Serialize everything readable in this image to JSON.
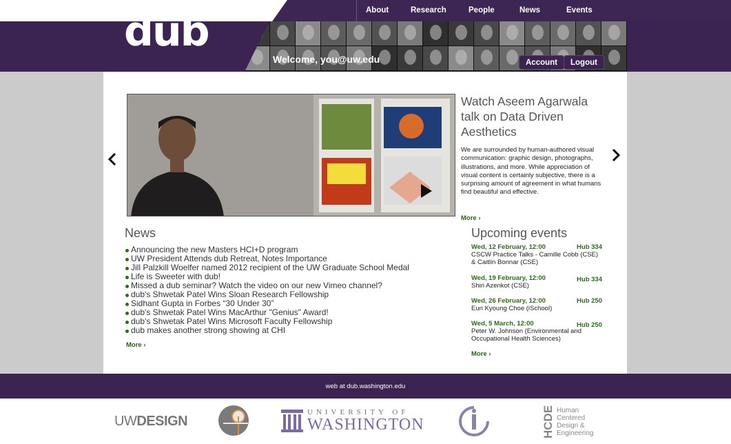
{
  "nav": {
    "items": [
      "About",
      "Research",
      "People",
      "News",
      "Events"
    ]
  },
  "header": {
    "logo_text": "dub",
    "welcome": "Welcome, you@uw.edu",
    "account_label": "Account",
    "logout_label": "Logout"
  },
  "featured": {
    "title": "Watch Aseem Agarwala talk on Data Driven Aesthetics",
    "description": "We are surrounded by human-authored visual communication: graphic design, photographs, illustrations, and more. While appreciation of visual content is certainly subjective, there is a surprising amount of agreement in what humans find beautiful and effective.",
    "more": "More ›"
  },
  "news": {
    "heading": "News",
    "items": [
      "Announcing the new Masters HCI+D program",
      "UW President Attends dub Retreat, Notes Importance",
      "Jill Palzkill Woelfer named 2012 recipient of the UW Graduate School Medal",
      "Life is Sweeter with dub!",
      "Missed a dub seminar? Watch the video on our new Vimeo channel?",
      "dub's Shwetak Patel Wins Sloan Research Fellowship",
      "Sidhant Gupta in Forbes “30 Under 30”",
      "dub's Shwetak Patel Wins MacArthur \"Genius\" Award!",
      "dub's Shwetak Patel Wins Microsoft Faculty Fellowship",
      "dub makes another strong showing at CHI"
    ],
    "more": "More ›"
  },
  "events": {
    "heading": "Upcoming events",
    "items": [
      {
        "date": "Wed, 12 February, 12:00",
        "location": "Hub 334",
        "title": "CSCW Practice Talks - Camille Cobb (CSE) & Caitlin Bonnar (CSE)"
      },
      {
        "date": "Wed, 19 February, 12:00",
        "location": "Hub 334",
        "title": "Shiri Azenkot (CSE)"
      },
      {
        "date": "Wed, 26 February, 12:00",
        "location": "Hub 250",
        "title": "Eun Kyoung Choe (iSchool)"
      },
      {
        "date": "Wed, 5 March, 12:00",
        "location": "Hub 250",
        "title": "Peter W. Johnson (Environmental and Occupational Health Sciences)"
      }
    ],
    "more": "More ›"
  },
  "footer": {
    "text": "web at dub.washington.edu"
  },
  "partners": {
    "uwdesign_light": "UW",
    "uwdesign_bold": "DESIGN",
    "uw_top": "UNIVERSITY OF",
    "uw_bottom": "WASHINGTON",
    "hcde_abbr": "HCDE",
    "hcde_lines": [
      "Human",
      "Centered",
      "Design &",
      "Engineering"
    ]
  },
  "colors": {
    "brand_purple": "#3b2352",
    "link_green": "#2a6d18",
    "uw_purple": "#7c6aa3"
  }
}
